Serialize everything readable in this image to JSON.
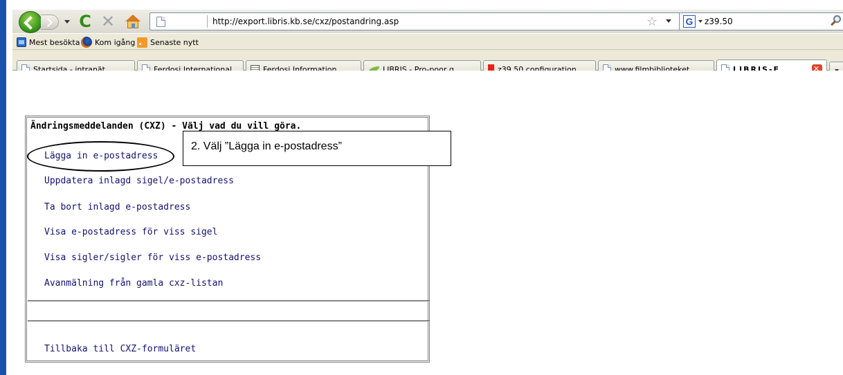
{
  "browser": {
    "url": "http://export.libris.kb.se/cxz/postandring.asp",
    "search_text": "z39.50"
  },
  "bookmarks": [
    {
      "label": "Mest besökta",
      "icon": "most-visited-icon"
    },
    {
      "label": "Kom igång",
      "icon": "firefox-icon"
    },
    {
      "label": "Senaste nytt",
      "icon": "rss-icon"
    }
  ],
  "tabs": [
    {
      "label": "Startsida - intranät",
      "icon": "page-icon"
    },
    {
      "label": "Ferdosi International",
      "icon": "page-icon"
    },
    {
      "label": "Ferdosi Information...",
      "icon": "grid-icon"
    },
    {
      "label": "LIBRIS - Pro-poor g...",
      "icon": "leaf-icon"
    },
    {
      "label": "z39.50 configuration",
      "icon": "red-flag-icon"
    },
    {
      "label": "www.filmbiblioteket...",
      "icon": "page-icon"
    },
    {
      "label": "LIBRIS-E...",
      "icon": "page-icon",
      "active": true
    }
  ],
  "page": {
    "title": "Ändringsmeddelanden (CXZ) - Välj vad du vill göra.",
    "links": [
      "Lägga in e-postadress",
      "Uppdatera inlagd sigel/e-postadress",
      "Ta bort inlagd e-postadress",
      "Visa e-postadress för viss sigel",
      "Visa sigler/sigler för viss e-postadress",
      "Avanmälning från gamla cxz-listan"
    ],
    "back_link": "Tillbaka till CXZ-formuläret"
  },
  "annotation": {
    "callout": "2. Välj ”Lägga in e-postadress”"
  }
}
